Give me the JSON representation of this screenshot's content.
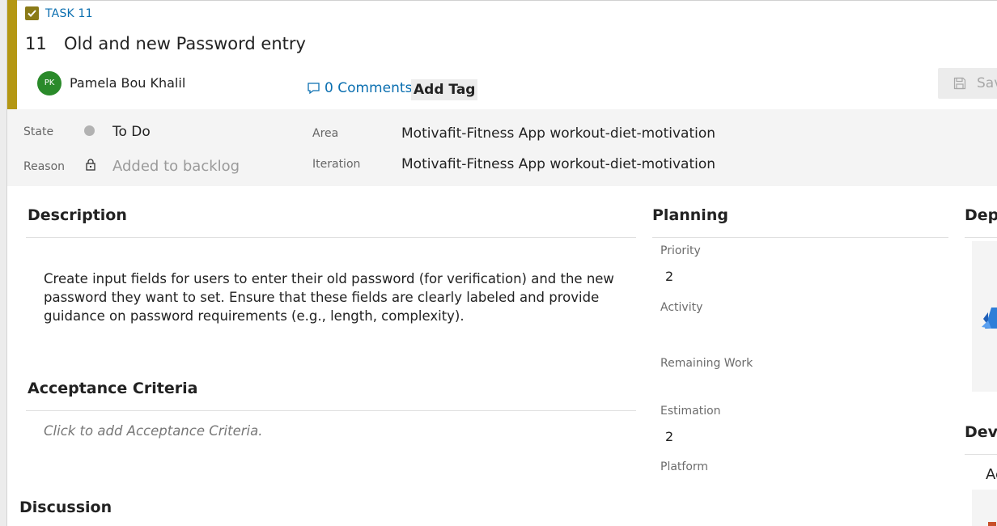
{
  "work_item": {
    "type_label": "TASK 11",
    "id": "11",
    "title": "Old and new Password entry",
    "assignee": {
      "initials": "PK",
      "name": "Pamela Bou Khalil"
    },
    "comments_label": "0 Comments",
    "add_tag_label": "Add Tag",
    "save_label": "Sav"
  },
  "fields": {
    "state_label": "State",
    "state_value": "To Do",
    "reason_label": "Reason",
    "reason_value": "Added to backlog",
    "area_label": "Area",
    "area_value": "Motivafit-Fitness App workout-diet-motivation",
    "iteration_label": "Iteration",
    "iteration_value": "Motivafit-Fitness App workout-diet-motivation"
  },
  "description": {
    "heading": "Description",
    "text": "Create input fields for users to enter their old password (for verification) and the new password they want to set. Ensure that these fields are clearly labeled and provide guidance on password requirements (e.g., length, complexity)."
  },
  "acceptance": {
    "heading": "Acceptance Criteria",
    "placeholder": "Click to add Acceptance Criteria."
  },
  "discussion": {
    "heading": "Discussion"
  },
  "planning": {
    "heading": "Planning",
    "priority_label": "Priority",
    "priority_value": "2",
    "activity_label": "Activity",
    "remaining_label": "Remaining Work",
    "estimation_label": "Estimation",
    "estimation_value": "2",
    "platform_label": "Platform"
  },
  "right_panel": {
    "deployment_heading": "Depl",
    "development_heading": "Deve",
    "development_item": "Ac"
  },
  "colors": {
    "accent": "#b49713",
    "link": "#0b6fb0",
    "avatar": "#2a8a2a",
    "state_dot": "#b2b2b2"
  },
  "icons": [
    "checkbox-icon",
    "comment-icon",
    "save-icon",
    "lock-icon",
    "azure-logo-icon"
  ]
}
